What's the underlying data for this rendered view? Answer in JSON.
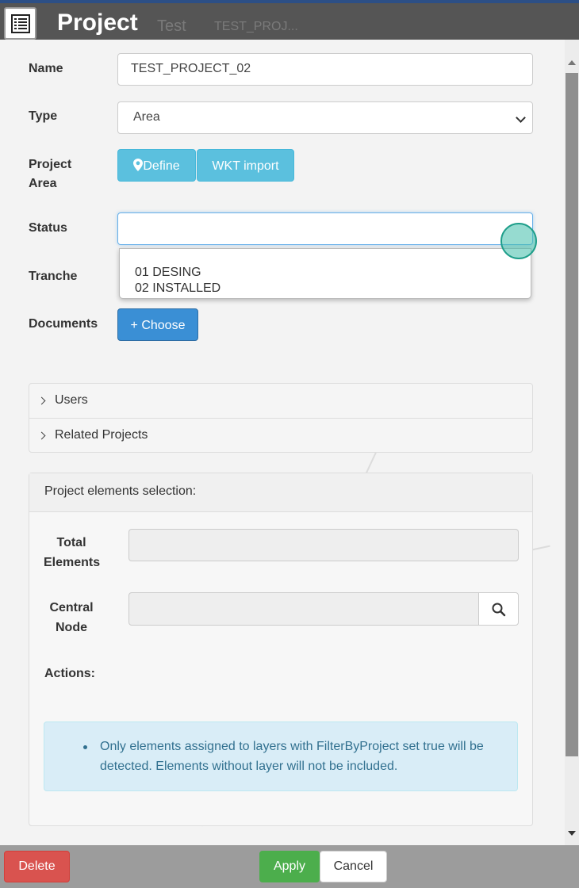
{
  "titlebar": {
    "title": "Project",
    "background_tab_1": "Test",
    "background_tab_2": "TEST_PROJ...",
    "icon": "list-icon"
  },
  "form": {
    "name_label": "Name",
    "name_value": "TEST_PROJECT_02",
    "type_label": "Type",
    "type_value": "Area",
    "project_area_label_line1": "Project",
    "project_area_label_line2": "Area",
    "define_button": "Define",
    "define_icon": "map-marker-icon",
    "wkt_import_button": "WKT import",
    "status_label": "Status",
    "status_value": "",
    "status_options": [
      "01 DESING",
      "02 INSTALLED"
    ],
    "tranche_label": "Tranche",
    "documents_label": "Documents",
    "choose_button": "+ Choose"
  },
  "accordion": {
    "users_label": "Users",
    "related_projects_label": "Related Projects"
  },
  "selection_panel": {
    "heading": "Project elements selection:",
    "total_elements_label_line1": "Total",
    "total_elements_label_line2": "Elements",
    "total_elements_value": "",
    "central_node_label_line1": "Central",
    "central_node_label_line2": "Node",
    "central_node_value": "",
    "search_icon": "search-icon",
    "actions_label": "Actions:",
    "info_text": "Only elements assigned to layers with FilterByProject set true will be detected. Elements without layer will not be included."
  },
  "footer": {
    "delete_label": "Delete",
    "apply_label": "Apply",
    "cancel_label": "Cancel"
  },
  "colors": {
    "titlebar": "#555555",
    "info_button": "#5bc0de",
    "primary_button": "#3a8fd5",
    "delete_button": "#d9534f",
    "apply_button": "#4cae4c",
    "alert_background": "#d9edf7"
  }
}
